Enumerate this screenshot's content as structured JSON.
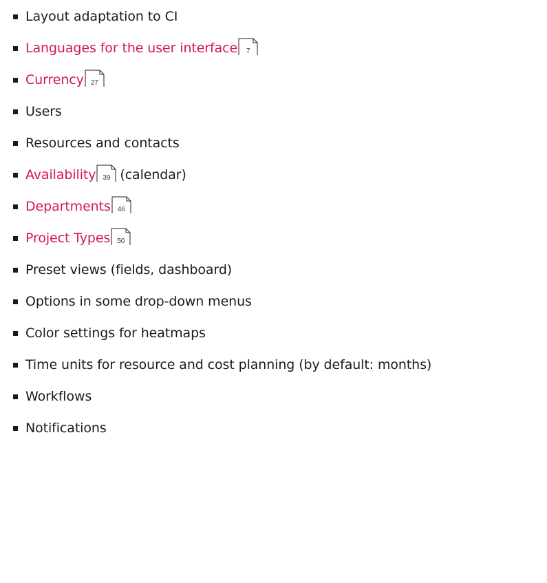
{
  "colors": {
    "link": "#d4145a",
    "text": "#1a1a1a"
  },
  "items": [
    {
      "text": "Layout adaptation to CI"
    },
    {
      "link": "Languages for the user interface",
      "page": "7"
    },
    {
      "link": "Currency",
      "page": "27"
    },
    {
      "text": "Users"
    },
    {
      "text": "Resources and contacts"
    },
    {
      "link": "Availability",
      "page": "39",
      "after": "(calendar)"
    },
    {
      "link": "Departments",
      "page": "46"
    },
    {
      "link": "Project Types",
      "page": "50"
    },
    {
      "text": "Preset views (fields, dashboard)"
    },
    {
      "text": "Options in some drop-down menus"
    },
    {
      "text": "Color settings for heatmaps"
    },
    {
      "text": "Time units for resource and cost planning (by default: months)"
    },
    {
      "text": "Workflows"
    },
    {
      "text": "Notifications"
    }
  ],
  "icons": {
    "bullet": "square-bullet-icon",
    "page_reference": "page-reference-icon"
  }
}
